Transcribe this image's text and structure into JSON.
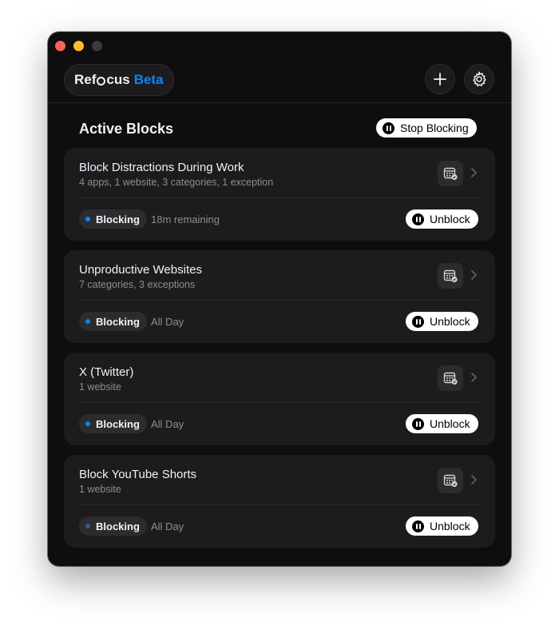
{
  "app": {
    "name_prefix": "Ref",
    "name_suffix": "cus",
    "beta_label": "Beta"
  },
  "toolbar": {
    "add_label": "+",
    "settings_icon": "gear-icon"
  },
  "section": {
    "title": "Active Blocks",
    "stop_label": "Stop Blocking"
  },
  "colors": {
    "accent": "#0a84ff",
    "background": "#0e0e0f",
    "card": "#1c1c1e"
  },
  "blocks": [
    {
      "title": "Block Distractions During Work",
      "subtitle": "4 apps, 1 website, 3 categories, 1 exception",
      "status": "Blocking",
      "time": "18m remaining",
      "action": "Unblock"
    },
    {
      "title": "Unproductive Websites",
      "subtitle": "7 categories, 3 exceptions",
      "status": "Blocking",
      "time": "All Day",
      "action": "Unblock"
    },
    {
      "title": "X (Twitter)",
      "subtitle": "1 website",
      "status": "Blocking",
      "time": "All Day",
      "action": "Unblock"
    },
    {
      "title": "Block YouTube Shorts",
      "subtitle": "1 website",
      "status": "Blocking",
      "time": "All Day",
      "action": "Unblock"
    }
  ]
}
